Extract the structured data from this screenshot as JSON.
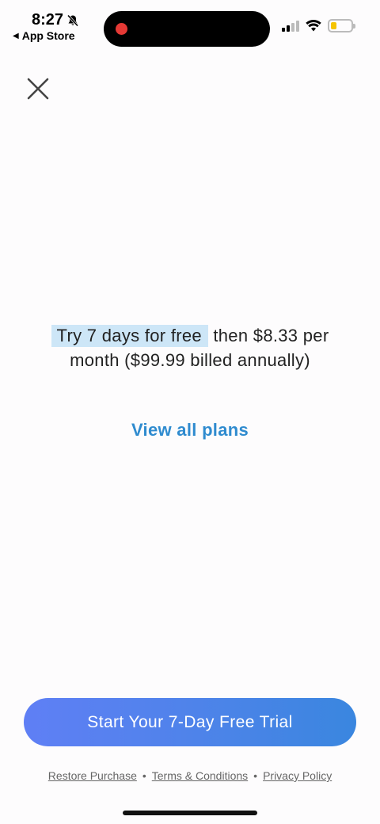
{
  "status_bar": {
    "time": "8:27",
    "back_app": "App Store",
    "battery_level": 0.3,
    "battery_color": "#f5c400"
  },
  "close": {
    "icon": "close-icon"
  },
  "offer": {
    "highlight": "Try 7 days for free",
    "rest": "then $8.33 per month ($99.99 billed annually)"
  },
  "view_plans_label": "View all plans",
  "cta_label": "Start Your 7-Day Free Trial",
  "footer": {
    "restore": "Restore Purchase",
    "terms": "Terms & Conditions",
    "privacy": "Privacy Policy",
    "separator": "•"
  },
  "colors": {
    "accent": "#2f8bcf",
    "cta_start": "#5f7ff5",
    "cta_end": "#3a86df",
    "highlight": "#cde6f7"
  }
}
